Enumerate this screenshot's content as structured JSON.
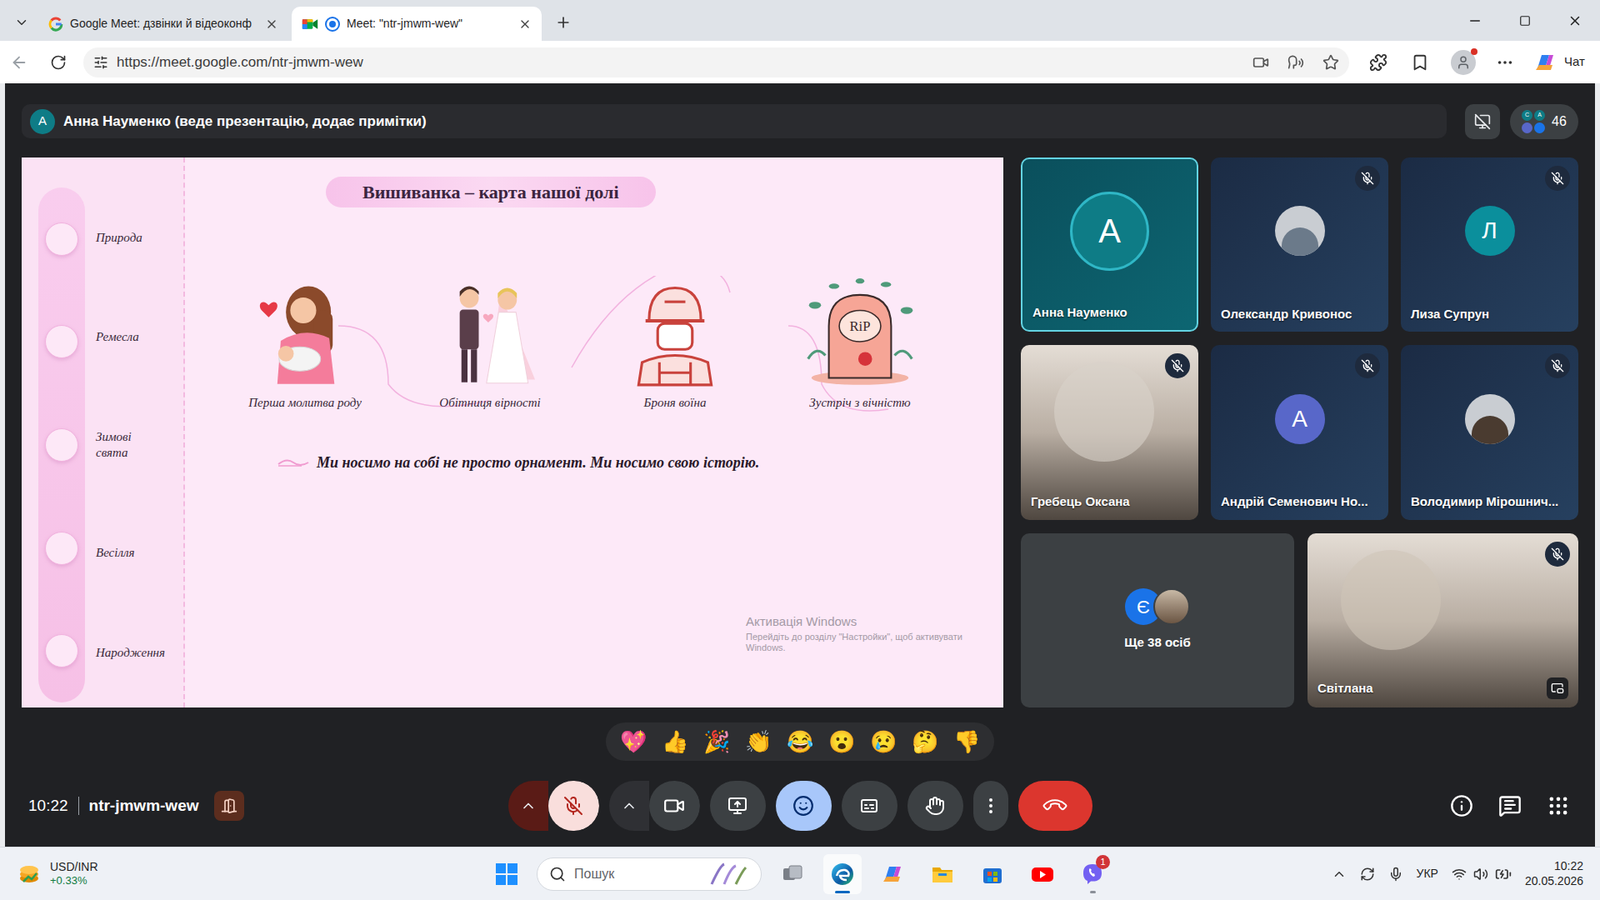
{
  "browser": {
    "tabs": [
      {
        "label": "Google Meet: дзвінки й відеоконф",
        "selected": false,
        "kind": "google",
        "recording": false
      },
      {
        "label": "Meet: \"ntr-jmwm-wew\"",
        "selected": true,
        "kind": "meet",
        "recording": true
      }
    ],
    "url": "https://meet.google.com/ntr-jmwm-wew",
    "copilot_label": "Чат",
    "profile_notification": true
  },
  "presenter_bar": {
    "avatar_initial": "А",
    "text": "Анна Науменко (веде презентацію, додає примітки)",
    "participant_count": "46",
    "mini_avatars": [
      "С",
      "А"
    ]
  },
  "slide": {
    "title": "Вишиванка – карта нашої долі",
    "timeline": [
      "Природа",
      "Ремесла",
      "Зимові свята",
      "Весілля",
      "Народження"
    ],
    "stages": [
      {
        "caption": "Перша молитва роду",
        "kind": "mother",
        "badge": ""
      },
      {
        "caption": "Обітниця вірності",
        "kind": "wedding",
        "badge": ""
      },
      {
        "caption": "Броня воїна",
        "kind": "soldier",
        "badge": ""
      },
      {
        "caption": "Зустріч з вічністю",
        "kind": "tombstone",
        "badge": "RiP"
      }
    ],
    "quote": "Ми носимо на собі не просто орнамент. Ми носимо свою історію.",
    "watermark": {
      "title": "Активація Windows",
      "text": "Перейдіть до розділу \"Настройки\", щоб активувати Windows."
    }
  },
  "participants": [
    {
      "name": "Анна Науменко",
      "kind": "avatar",
      "initial": "А",
      "color": "#0e7c86",
      "muted": false,
      "speaking": true,
      "pip": false
    },
    {
      "name": "Олександр Кривонос",
      "kind": "photo",
      "initial": "",
      "color": "#6b7a8a",
      "muted": true,
      "speaking": false,
      "pip": false
    },
    {
      "name": "Лиза Супрун",
      "kind": "avatar",
      "initial": "Л",
      "color": "#0b8f9c",
      "muted": true,
      "speaking": false,
      "pip": false
    },
    {
      "name": "Гребець Оксана",
      "kind": "video",
      "initial": "",
      "color": "#d9d2ca",
      "muted": true,
      "speaking": false,
      "pip": false
    },
    {
      "name": "Андрій Семенович Но...",
      "kind": "avatar",
      "initial": "А",
      "color": "#5867c9",
      "muted": true,
      "speaking": false,
      "pip": false
    },
    {
      "name": "Володимир Мірошнич...",
      "kind": "photo",
      "initial": "",
      "color": "#4a3b30",
      "muted": true,
      "speaking": false,
      "pip": false
    },
    {
      "name": "Світлана",
      "kind": "video",
      "initial": "",
      "color": "#cfc4b8",
      "muted": true,
      "speaking": false,
      "pip": true
    }
  ],
  "others": {
    "initial": "Є",
    "label": "Ще 38 осіб"
  },
  "reactions": [
    "💖",
    "👍",
    "🎉",
    "👏",
    "😂",
    "😮",
    "😢",
    "🤔",
    "👎"
  ],
  "meeting": {
    "time": "10:22",
    "code": "ntr-jmwm-wew"
  },
  "controls": [
    {
      "kind": "mic",
      "muted": true,
      "selected": false
    },
    {
      "kind": "camera",
      "muted": false,
      "selected": false
    },
    {
      "kind": "present",
      "muted": false,
      "selected": false
    },
    {
      "kind": "reactions",
      "muted": false,
      "selected": true
    },
    {
      "kind": "captions",
      "muted": false,
      "selected": false
    },
    {
      "kind": "hand",
      "muted": false,
      "selected": false
    },
    {
      "kind": "more",
      "muted": false,
      "selected": false
    },
    {
      "kind": "leave",
      "muted": false,
      "selected": false
    }
  ],
  "taskbar": {
    "widget": {
      "label": "USD/INR",
      "change": "+0.33%"
    },
    "search_placeholder": "Пошук",
    "apps": [
      {
        "kind": "task-view",
        "selected": false,
        "running": false,
        "badge": ""
      },
      {
        "kind": "edge",
        "selected": true,
        "running": true,
        "badge": ""
      },
      {
        "kind": "copilot",
        "selected": false,
        "running": false,
        "badge": ""
      },
      {
        "kind": "explorer",
        "selected": false,
        "running": false,
        "badge": ""
      },
      {
        "kind": "store",
        "selected": false,
        "running": false,
        "badge": ""
      },
      {
        "kind": "youtube",
        "selected": false,
        "running": false,
        "badge": ""
      },
      {
        "kind": "viber",
        "selected": false,
        "running": true,
        "badge": "1"
      }
    ],
    "language": "УКР",
    "time": "10:22",
    "date": "20.05.2026"
  }
}
